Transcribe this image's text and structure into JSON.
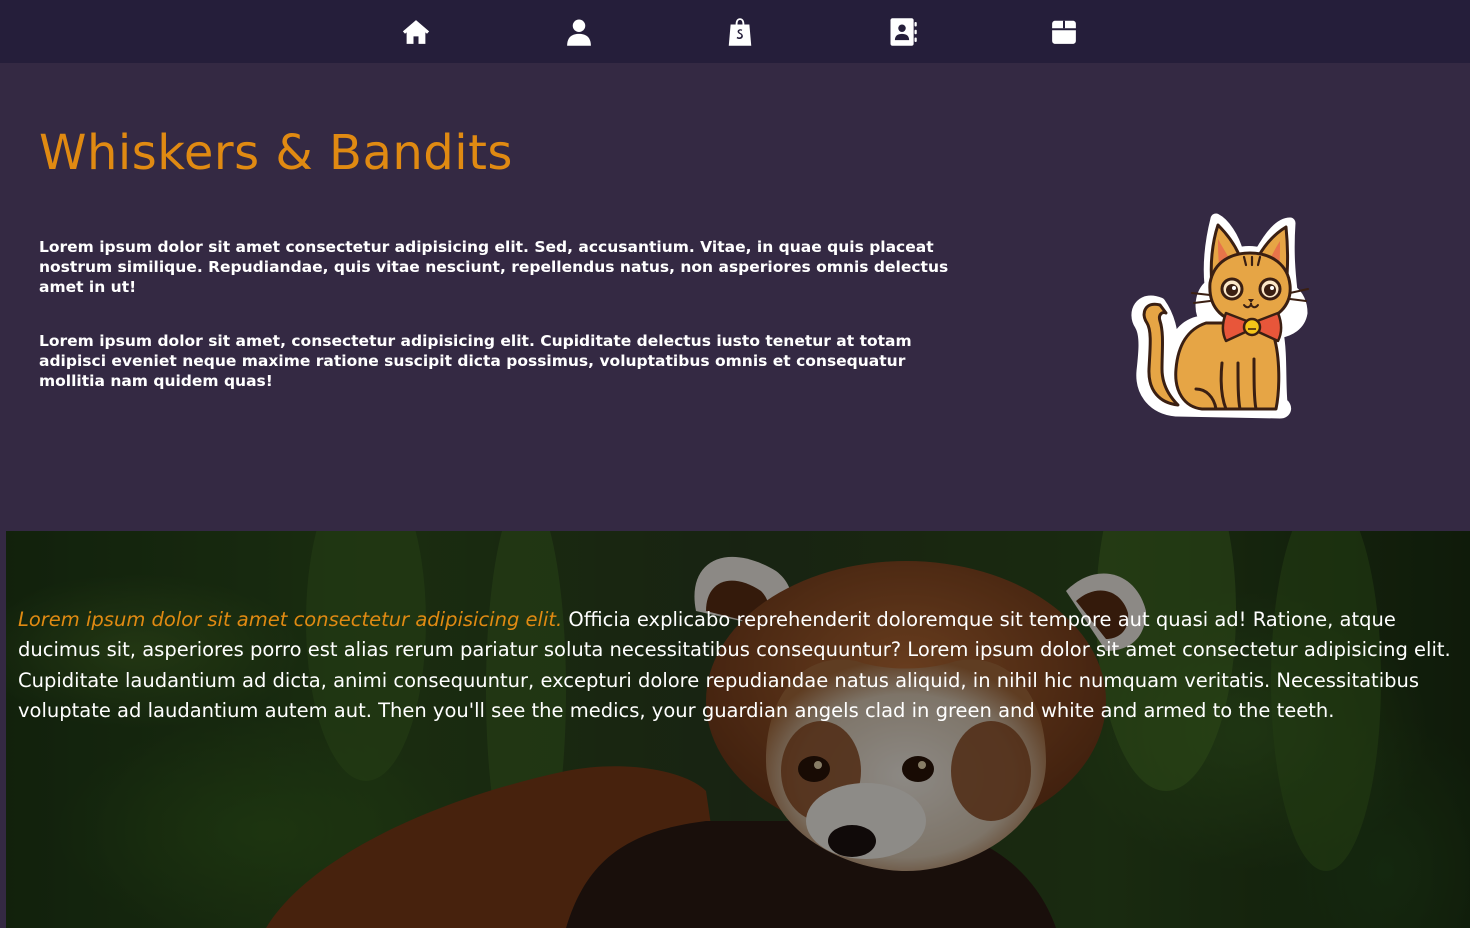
{
  "nav": {
    "items": [
      {
        "icon": "home-icon"
      },
      {
        "icon": "user-icon"
      },
      {
        "icon": "shopping-bag-icon"
      },
      {
        "icon": "address-book-icon"
      },
      {
        "icon": "box-icon"
      }
    ]
  },
  "hero": {
    "title": "Whiskers & Bandits",
    "paragraph1": "Lorem ipsum dolor sit amet consectetur adipisicing elit. Sed, accusantium. Vitae, in quae quis placeat nostrum similique. Repudiandae, quis vitae nesciunt, repellendus natus, non asperiores omnis delectus amet in ut!",
    "paragraph2": "Lorem ipsum dolor sit amet, consectetur adipisicing elit. Cupiditate delectus iusto tenetur at totam adipisci eveniet neque maxime ratione suscipit dicta possimus, voluptatibus omnis et consequatur mollitia nam quidem quas!",
    "illustration": "cat-illustration"
  },
  "panda_section": {
    "lead": "Lorem ipsum dolor sit amet consectetur adipisicing elit.",
    "body": " Officia explicabo reprehenderit doloremque sit tempore aut quasi ad! Ratione, atque ducimus sit, asperiores porro est alias rerum pariatur soluta necessitatibus consequuntur? Lorem ipsum dolor sit amet consectetur adipisicing elit. Cupiditate laudantium ad dicta, animi consequuntur, excepturi dolore repudiandae natus aliquid, in nihil hic numquam veritatis. Necessitatibus voluptate ad laudantium autem aut. Then you'll see the medics, your guardian angels clad in green and white and armed to the teeth.",
    "background": "red-panda-photo"
  },
  "colors": {
    "nav_bg": "#251e3a",
    "page_bg": "#342943",
    "accent": "#e08a12",
    "text": "#ffffff"
  }
}
